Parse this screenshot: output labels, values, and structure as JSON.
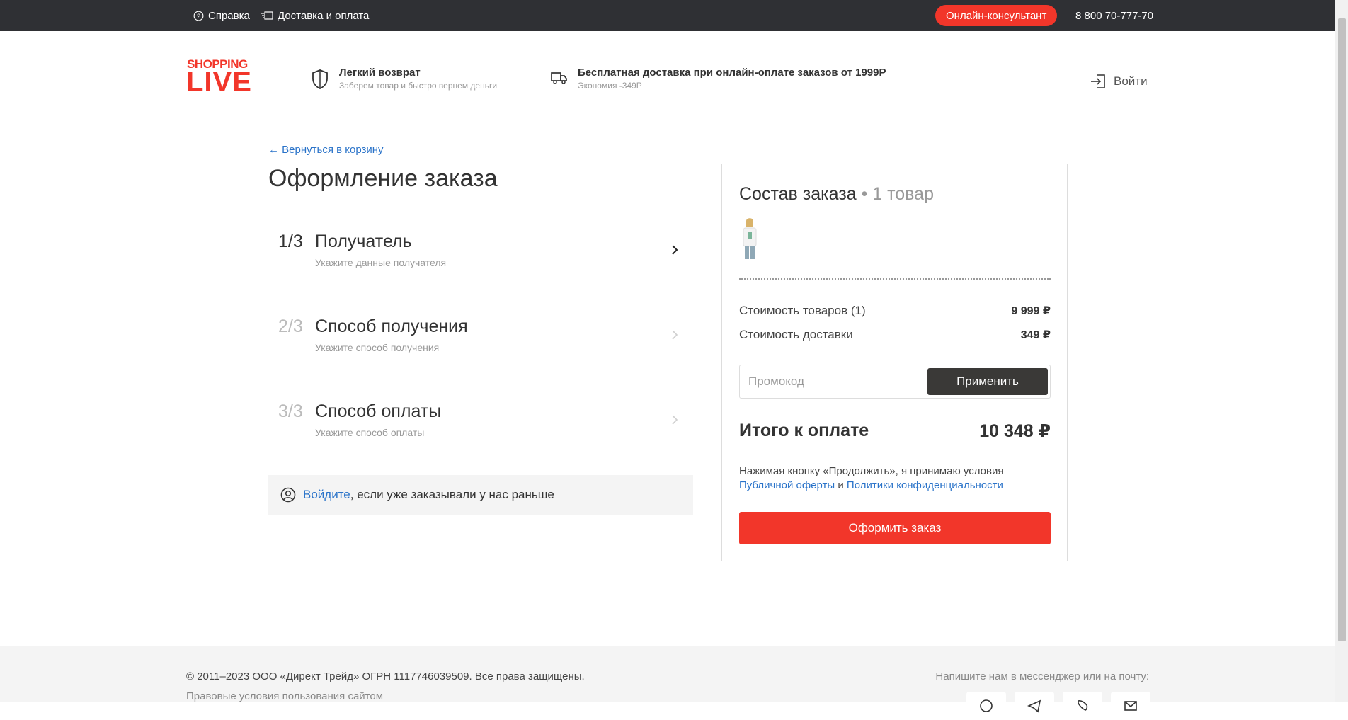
{
  "topbar": {
    "help_label": "Справка",
    "delivery_label": "Доставка и оплата",
    "consultant_label": "Онлайн-консультант",
    "phone": "8 800 70-777-70"
  },
  "header": {
    "logo_top": "SHOPPING",
    "logo_bottom": "LIVE",
    "return_title": "Легкий возврат",
    "return_sub": "Заберем товар и быстро вернем деньги",
    "delivery_title": "Бесплатная доставка при онлайн-оплате заказов от 1999Р",
    "delivery_sub": "Экономия -349Р",
    "login_label": "Войти"
  },
  "checkout": {
    "back_link": "← Вернуться в корзину",
    "title": "Оформление заказа",
    "steps": [
      {
        "num": "1/3",
        "name": "Получатель",
        "hint": "Укажите данные получателя"
      },
      {
        "num": "2/3",
        "name": "Способ получения",
        "hint": "Укажите способ получения"
      },
      {
        "num": "3/3",
        "name": "Способ оплаты",
        "hint": "Укажите способ оплаты"
      }
    ],
    "login_banner": {
      "link": "Войдите",
      "text": ", если уже заказывали у нас раньше"
    }
  },
  "summary": {
    "title": "Состав заказа",
    "count": "• 1 товар",
    "goods_label": "Стоимость товаров (1)",
    "goods_value": "9 999 ₽",
    "delivery_label": "Стоимость доставки",
    "delivery_value": "349 ₽",
    "promo_placeholder": "Промокод",
    "apply_label": "Применить",
    "total_label": "Итого к оплате",
    "total_value": "10 348 ₽",
    "terms_text": "Нажимая кнопку «Продолжить», я принимаю условия",
    "terms_link1": "Публичной оферты",
    "terms_and": " и ",
    "terms_link2": "Политики конфиденциальности",
    "submit_label": "Оформить заказ"
  },
  "footer": {
    "copyright": "© 2011–2023 ООО «Директ Трейд» ОГРН 1117746039509. Все права защищены.",
    "legal_link": "Правовые условия пользования сайтом",
    "messenger_text": "Напишите нам в мессенджер или на почту:"
  },
  "colors": {
    "brand_red": "#f2362a",
    "topbar_bg": "#2f3034",
    "link_blue": "#2a73c9",
    "dark_button": "#3a3937"
  },
  "icons": [
    "help-icon",
    "delivery-icon",
    "shield-icon",
    "truck-icon",
    "login-icon",
    "chevron-right-icon",
    "user-circle-icon",
    "whatsapp-icon",
    "telegram-icon",
    "viber-icon",
    "email-icon"
  ]
}
